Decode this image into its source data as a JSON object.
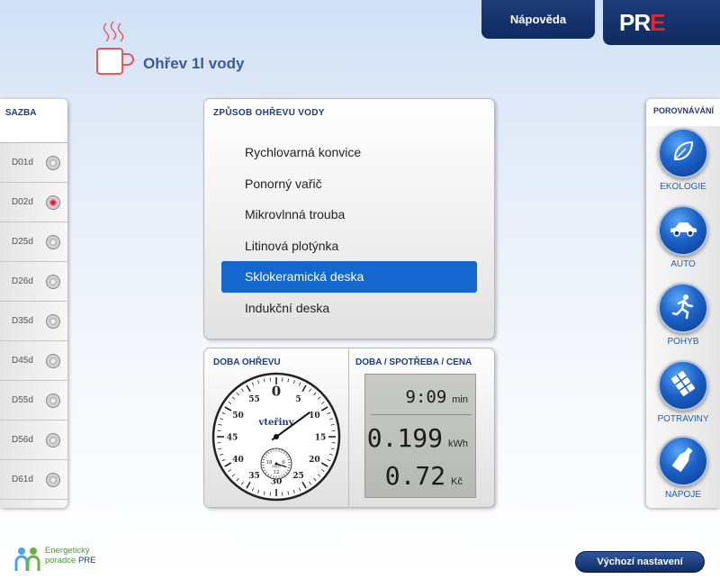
{
  "header": {
    "help_label": "Nápověda",
    "logo_pr": "PR",
    "logo_e": "E",
    "title": "Ohřev 1l vody"
  },
  "tariffs": {
    "heading": "SAZBA",
    "items": [
      {
        "label": "D01d",
        "selected": false
      },
      {
        "label": "D02d",
        "selected": true
      },
      {
        "label": "D25d",
        "selected": false
      },
      {
        "label": "D26d",
        "selected": false
      },
      {
        "label": "D35d",
        "selected": false
      },
      {
        "label": "D45d",
        "selected": false
      },
      {
        "label": "D55d",
        "selected": false
      },
      {
        "label": "D56d",
        "selected": false
      },
      {
        "label": "D61d",
        "selected": false
      }
    ]
  },
  "methods": {
    "heading": "ZPŮSOB OHŘEVU VODY",
    "items": [
      {
        "label": "Rychlovarná konvice",
        "selected": false
      },
      {
        "label": "Ponorný vařič",
        "selected": false
      },
      {
        "label": "Mikrovlnná trouba",
        "selected": false
      },
      {
        "label": "Litinová plotýnka",
        "selected": false
      },
      {
        "label": "Sklokeramická deska",
        "selected": true
      },
      {
        "label": "Indukční deska",
        "selected": false
      }
    ]
  },
  "duration": {
    "heading": "DOBA OHŘEVU",
    "dial_label": "vteřiny",
    "subdial_label": "min",
    "second_numbers": [
      "0",
      "5",
      "10",
      "15",
      "20",
      "25",
      "30",
      "35",
      "40",
      "45",
      "50",
      "55"
    ],
    "minute_numbers": [
      "18",
      "6",
      "12"
    ],
    "elapsed_minutes": 9,
    "elapsed_seconds": 9
  },
  "readout": {
    "heading": "DOBA / SPOTŘEBA / CENA",
    "time_value": "9:09",
    "time_unit": "min",
    "energy_value": "0.199",
    "energy_unit": "kWh",
    "price_value": "0.72",
    "price_unit": "Kč"
  },
  "comparison": {
    "heading": "POROVNÁVÁNÍ",
    "items": [
      {
        "label": "EKOLOGIE",
        "icon": "leaf-icon"
      },
      {
        "label": "AUTO",
        "icon": "car-icon"
      },
      {
        "label": "POHYB",
        "icon": "running-person-icon"
      },
      {
        "label": "POTRAVINY",
        "icon": "chocolate-icon"
      },
      {
        "label": "NÁPOJE",
        "icon": "bottle-icon"
      }
    ]
  },
  "footer": {
    "brand_line1": "Energetický",
    "brand_line2": "poradce",
    "brand_line2b": "PRE",
    "reset_label": "Výchozí nastavení"
  },
  "colors": {
    "accent": "#1467cc",
    "navy": "#1e3c79",
    "brand_red": "#e3252d",
    "selected_radio": "#d52b1e"
  }
}
